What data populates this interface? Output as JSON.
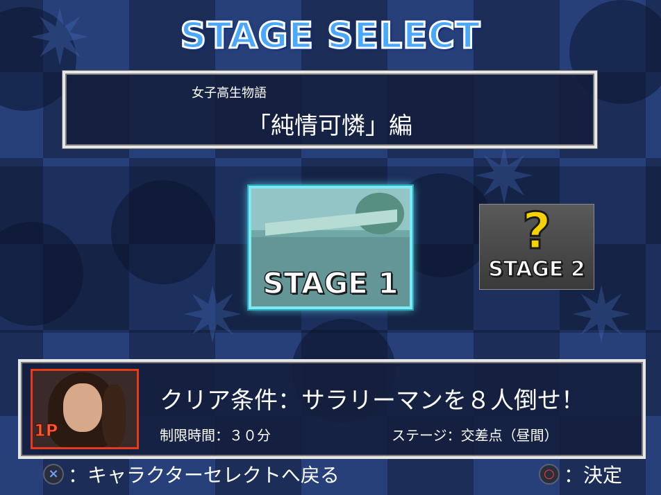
{
  "header": {
    "title": "STAGE SELECT"
  },
  "scenario": {
    "subtitle": "女子高生物語",
    "chapter": "「純情可憐」編"
  },
  "stages": [
    {
      "label": "STAGE 1",
      "state": "selected",
      "preview": "bridge-street-scene"
    },
    {
      "label": "STAGE 2",
      "state": "locked",
      "icon": "question-mark-icon"
    }
  ],
  "details": {
    "player_badge": "1P",
    "clear_condition": "クリア条件：サラリーマンを８人倒せ！",
    "time_limit": "制限時間：３０分",
    "stage_location": "ステージ：交差点（昼間）"
  },
  "controls": {
    "back_icon": "×",
    "back_label": "：キャラクターセレクトへ戻る",
    "confirm_icon": "○",
    "confirm_label": "：決定"
  },
  "colors": {
    "title_fill": "#4aa8ff",
    "selected_border": "#7fe8f2",
    "question_mark": "#f6d300",
    "player_badge": "#ff5a2a"
  }
}
